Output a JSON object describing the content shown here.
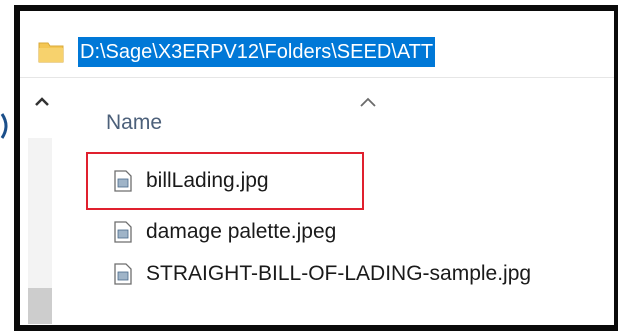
{
  "address_bar": {
    "path": "D:\\Sage\\X3ERPV12\\Folders\\SEED\\ATT",
    "selected_color": "#0078d7"
  },
  "file_list": {
    "column_header": "Name",
    "sort_indicator": "chevron-up",
    "files": [
      {
        "name": "billLading.jpg",
        "icon": "image-file-icon",
        "highlighted": true
      },
      {
        "name": "damage palette.jpeg",
        "icon": "image-file-icon",
        "highlighted": false
      },
      {
        "name": "STRAIGHT-BILL-OF-LADING-sample.jpg",
        "icon": "image-file-icon",
        "highlighted": false
      }
    ]
  },
  "colors": {
    "highlight_border": "#e0202e",
    "frame_border": "#0a0a0a",
    "folder_icon": "#f4c653"
  }
}
